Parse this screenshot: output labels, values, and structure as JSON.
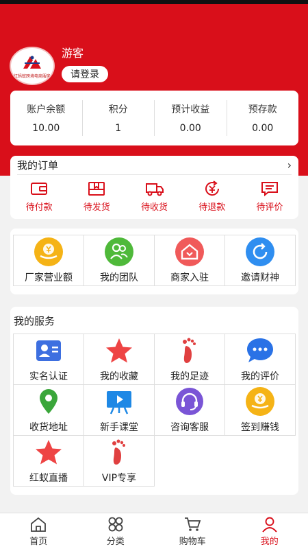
{
  "header": {
    "username": "游客",
    "login_label": "请登录",
    "logo_text": "红蚂蚁跨境电商服务"
  },
  "stats": [
    {
      "label": "账户余额",
      "value": "10.00"
    },
    {
      "label": "积分",
      "value": "1"
    },
    {
      "label": "预计收益",
      "value": "0.00"
    },
    {
      "label": "预存款",
      "value": "0.00"
    }
  ],
  "orders": {
    "title": "我的订单",
    "chevron": "›",
    "items": [
      {
        "label": "待付款",
        "icon": "wallet-icon"
      },
      {
        "label": "待发货",
        "icon": "package-icon"
      },
      {
        "label": "待收货",
        "icon": "truck-icon"
      },
      {
        "label": "待退款",
        "icon": "refund-icon"
      },
      {
        "label": "待评价",
        "icon": "comment-icon"
      }
    ]
  },
  "features": [
    {
      "label": "厂家营业额",
      "icon": "yen-hand-icon",
      "color": "#f5b316"
    },
    {
      "label": "我的团队",
      "icon": "team-icon",
      "color": "#4fb93a"
    },
    {
      "label": "商家入驻",
      "icon": "shop-home-icon",
      "color": "#f05a5a"
    },
    {
      "label": "邀请财神",
      "icon": "refresh-icon",
      "color": "#2f8ef0"
    }
  ],
  "services": {
    "title": "我的服务",
    "items": [
      {
        "label": "实名认证",
        "icon": "id-card-icon",
        "color": "#3d6fe0"
      },
      {
        "label": "我的收藏",
        "icon": "star-icon",
        "color": "#ee4444"
      },
      {
        "label": "我的足迹",
        "icon": "footprint-icon",
        "color": "#e04040"
      },
      {
        "label": "我的评价",
        "icon": "chat-bubble-icon",
        "color": "#2a72e6"
      },
      {
        "label": "收货地址",
        "icon": "location-pin-icon",
        "color": "#3aa63a"
      },
      {
        "label": "新手课堂",
        "icon": "video-board-icon",
        "color": "#1e88e5"
      },
      {
        "label": "咨询客服",
        "icon": "headset-icon",
        "color": "#7a55d6"
      },
      {
        "label": "签到赚钱",
        "icon": "yen-hand-icon",
        "color": "#f5b316"
      },
      {
        "label": "红蚁直播",
        "icon": "star-icon",
        "color": "#ee4444"
      },
      {
        "label": "VIP专享",
        "icon": "footprint-icon",
        "color": "#e04040"
      }
    ]
  },
  "tabbar": [
    {
      "label": "首页",
      "icon": "home-icon",
      "active": false
    },
    {
      "label": "分类",
      "icon": "category-icon",
      "active": false
    },
    {
      "label": "购物车",
      "icon": "cart-icon",
      "active": false
    },
    {
      "label": "我的",
      "icon": "user-icon",
      "active": true
    }
  ],
  "colors": {
    "brand_red": "#d90f1a",
    "background": "#f2f2f2"
  }
}
